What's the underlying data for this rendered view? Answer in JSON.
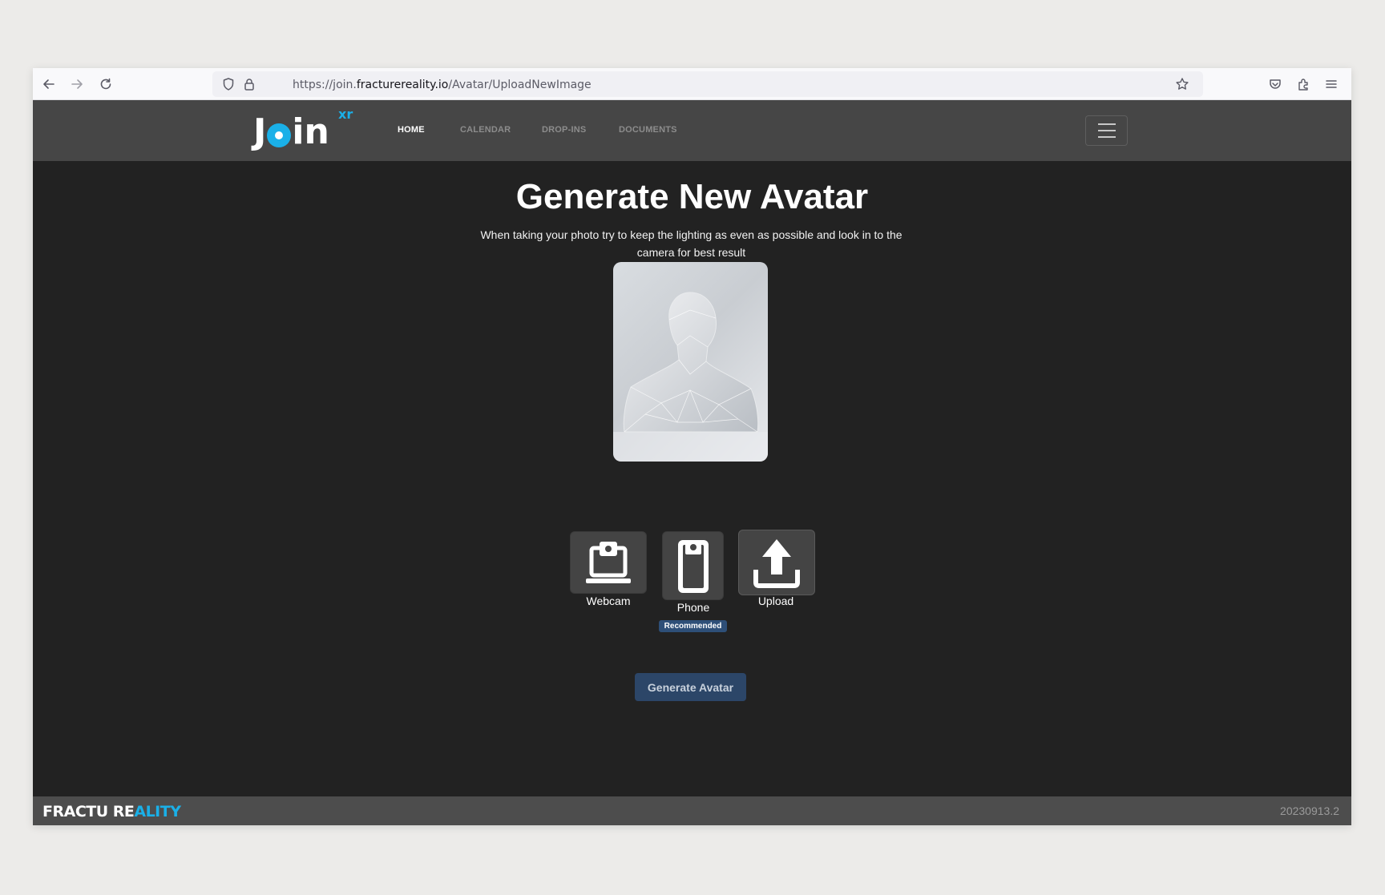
{
  "browser": {
    "url_prefix": "https://join.",
    "url_host": "fracturereality.io",
    "url_path": "/Avatar/UploadNewImage",
    "icons": [
      "back-arrow-icon",
      "forward-arrow-icon",
      "reload-icon",
      "shield-icon",
      "lock-icon",
      "star-icon",
      "pocket-icon",
      "extensions-icon",
      "menu-icon"
    ]
  },
  "nav": {
    "logo_text_a": "J",
    "logo_text_b": "in",
    "logo_sup": "xr",
    "links": [
      "HOME",
      "CALENDAR",
      "DROP-INS",
      "DOCUMENTS"
    ],
    "active": "HOME"
  },
  "main": {
    "title": "Generate New Avatar",
    "subtitle": "When taking your photo try to keep the lighting as even as possible and look in to the camera for best result",
    "sources": {
      "webcam": "Webcam",
      "phone": "Phone",
      "upload": "Upload"
    },
    "phone_badge": "Recommended",
    "generate_button": "Generate Avatar"
  },
  "footer": {
    "brand_white": "FRACTURE",
    "brand_blue": "ALITY",
    "brand_mid": "RE",
    "version": "20230913.2"
  },
  "colors": {
    "accent": "#1ab0e8",
    "background": "#222222",
    "navbar": "#464646",
    "button": "#2c4668"
  }
}
